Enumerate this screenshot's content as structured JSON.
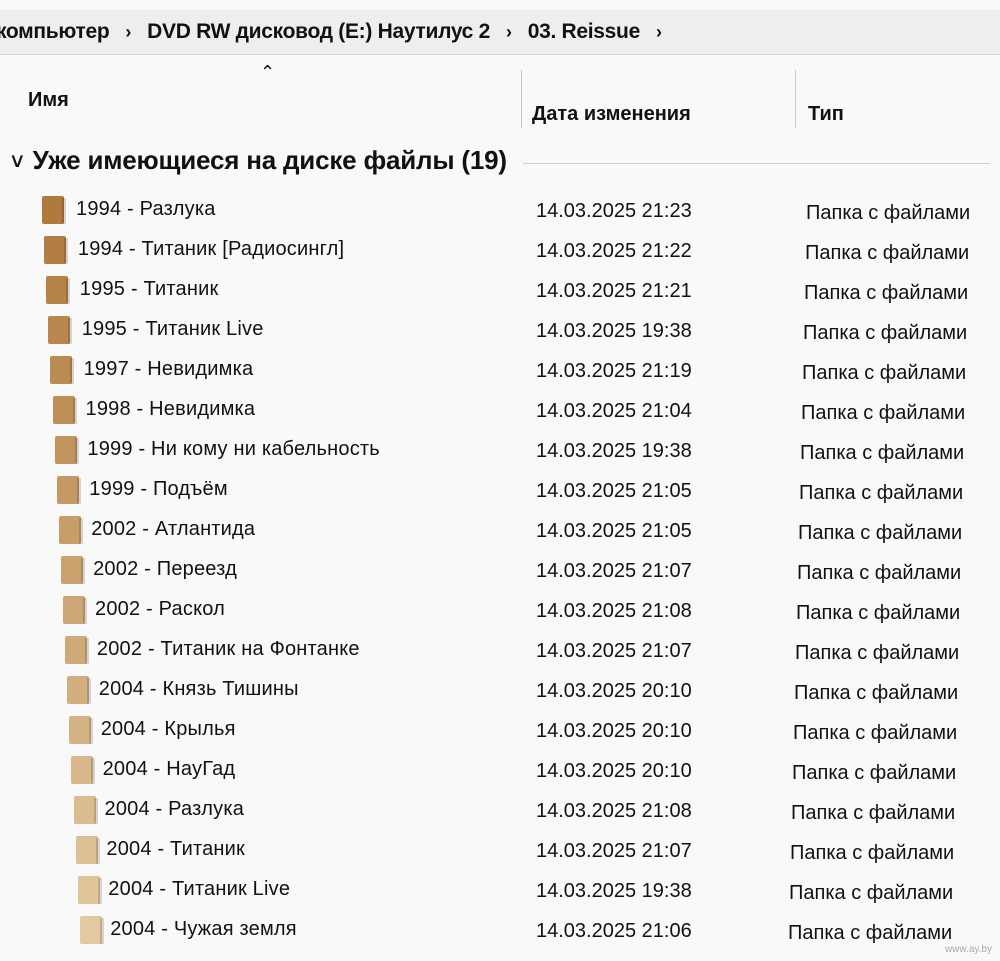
{
  "breadcrumb": [
    "компьютер",
    "DVD RW дисковод (E:) Наутилус 2",
    "03. Reissue"
  ],
  "columns": {
    "name": "Имя",
    "date": "Дата изменения",
    "type": "Тип"
  },
  "group": {
    "title": "Уже имеющиеся на диске файлы (19)"
  },
  "colors": {
    "folder_dark": "#b07a3c",
    "folder_light": "#e3c9a0"
  },
  "files": [
    {
      "name": "1994 - Разлука",
      "date": "14.03.2025 21:23",
      "type": "Папка с файлами"
    },
    {
      "name": "1994 - Титаник [Радиосингл]",
      "date": "14.03.2025 21:22",
      "type": "Папка с файлами"
    },
    {
      "name": "1995 - Титаник",
      "date": "14.03.2025 21:21",
      "type": "Папка с файлами"
    },
    {
      "name": "1995 - Титаник Live",
      "date": "14.03.2025 19:38",
      "type": "Папка с файлами"
    },
    {
      "name": "1997 - Невидимка",
      "date": "14.03.2025 21:19",
      "type": "Папка с файлами"
    },
    {
      "name": "1998 - Невидимка",
      "date": "14.03.2025 21:04",
      "type": "Папка с файлами"
    },
    {
      "name": "1999 - Ни кому ни кабельность",
      "date": "14.03.2025 19:38",
      "type": "Папка с файлами"
    },
    {
      "name": "1999 - Подъём",
      "date": "14.03.2025 21:05",
      "type": "Папка с файлами"
    },
    {
      "name": "2002 - Атлантида",
      "date": "14.03.2025 21:05",
      "type": "Папка с файлами"
    },
    {
      "name": "2002 - Переезд",
      "date": "14.03.2025 21:07",
      "type": "Папка с файлами"
    },
    {
      "name": "2002 - Раскол",
      "date": "14.03.2025 21:08",
      "type": "Папка с файлами"
    },
    {
      "name": "2002 - Титаник на Фонтанке",
      "date": "14.03.2025 21:07",
      "type": "Папка с файлами"
    },
    {
      "name": "2004 - Князь Тишины",
      "date": "14.03.2025 20:10",
      "type": "Папка с файлами"
    },
    {
      "name": "2004 - Крылья",
      "date": "14.03.2025 20:10",
      "type": "Папка с файлами"
    },
    {
      "name": "2004 - НауГад",
      "date": "14.03.2025 20:10",
      "type": "Папка с файлами"
    },
    {
      "name": "2004 - Разлука",
      "date": "14.03.2025 21:08",
      "type": "Папка с файлами"
    },
    {
      "name": "2004 - Титаник",
      "date": "14.03.2025 21:07",
      "type": "Папка с файлами"
    },
    {
      "name": "2004 - Титаник Live",
      "date": "14.03.2025 19:38",
      "type": "Папка с файлами"
    },
    {
      "name": "2004 - Чужая земля",
      "date": "14.03.2025 21:06",
      "type": "Папка с файлами"
    }
  ],
  "watermark": "www.ay.by"
}
